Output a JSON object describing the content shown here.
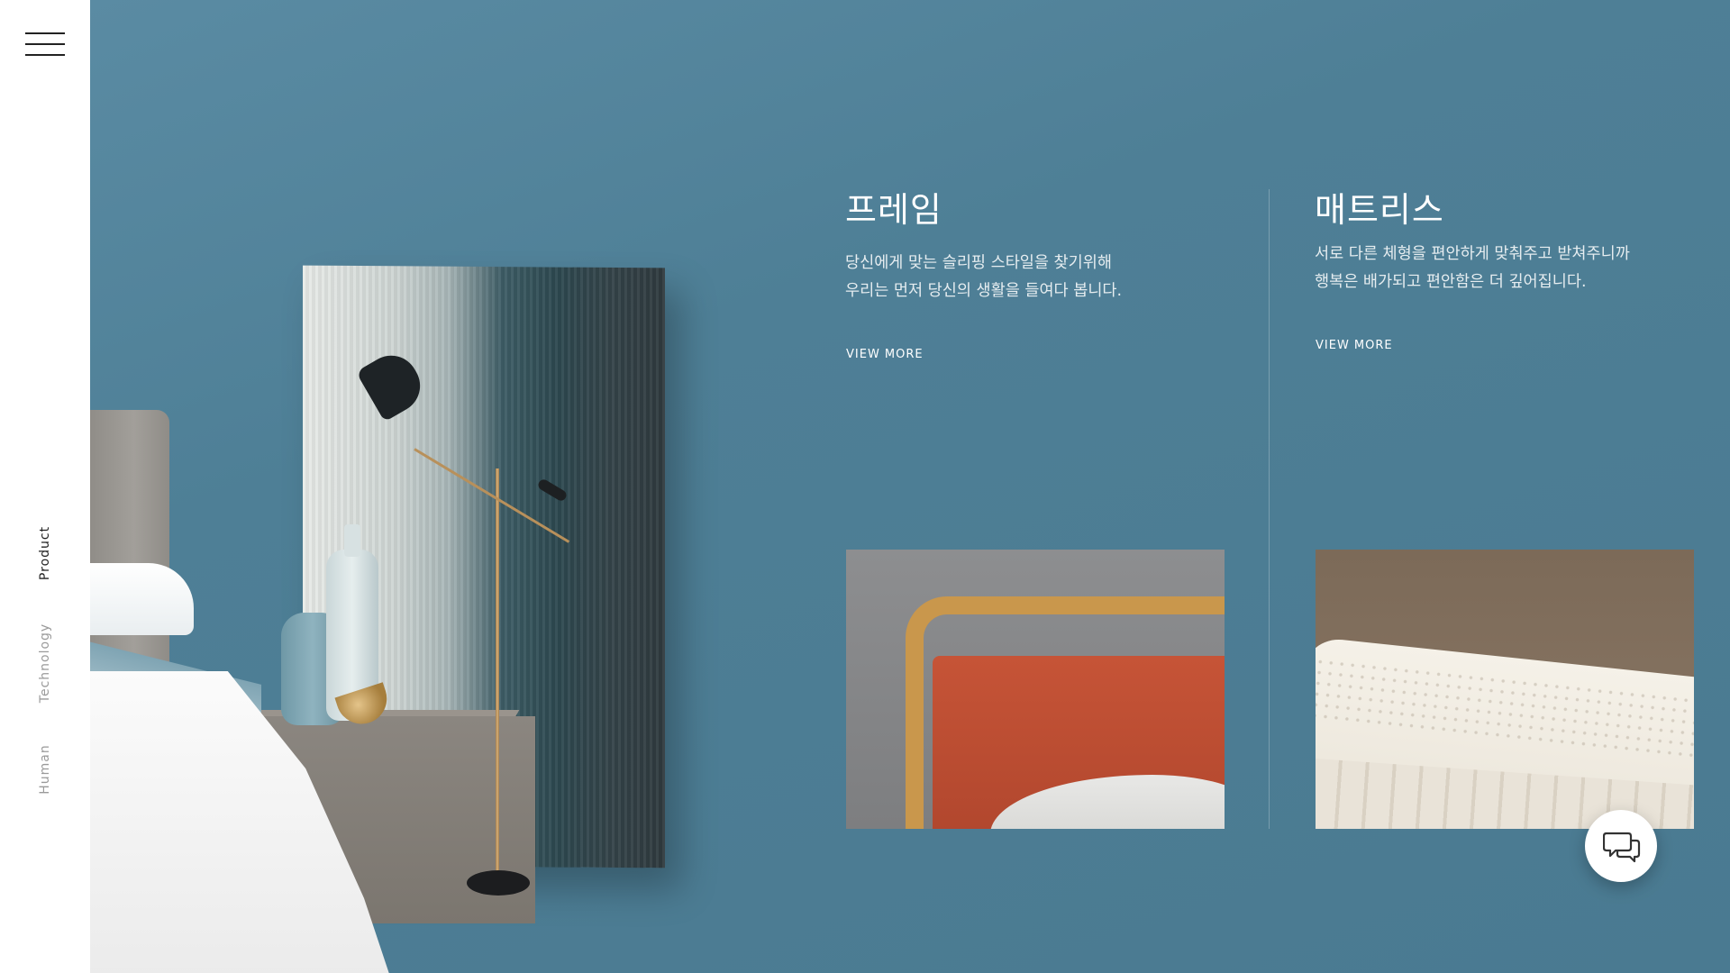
{
  "nav": {
    "menu_label": "",
    "items": [
      {
        "label": "Product",
        "active": true
      },
      {
        "label": "Technology",
        "active": false
      },
      {
        "label": "Human",
        "active": false
      }
    ]
  },
  "products": [
    {
      "title": "프레임",
      "desc_line1": "당신에게 맞는 슬리핑 스타일을 찾기위해",
      "desc_line2": "우리는 먼저 당신의 생활을 들여다 봅니다.",
      "link": "VIEW MORE"
    },
    {
      "title": "매트리스",
      "desc_line1": "서로 다른 체형을 편안하게 맞춰주고 받쳐주니까",
      "desc_line2": "행복은 배가되고 편안함은 더 깊어집니다.",
      "link": "VIEW MORE"
    }
  ],
  "colors": {
    "background": "#4e7f96",
    "sidebar": "#ffffff",
    "nav_active": "#222222",
    "nav_inactive": "#9a9a9a"
  },
  "icons": {
    "menu": "hamburger-icon",
    "chat": "chat-bubbles-icon"
  }
}
